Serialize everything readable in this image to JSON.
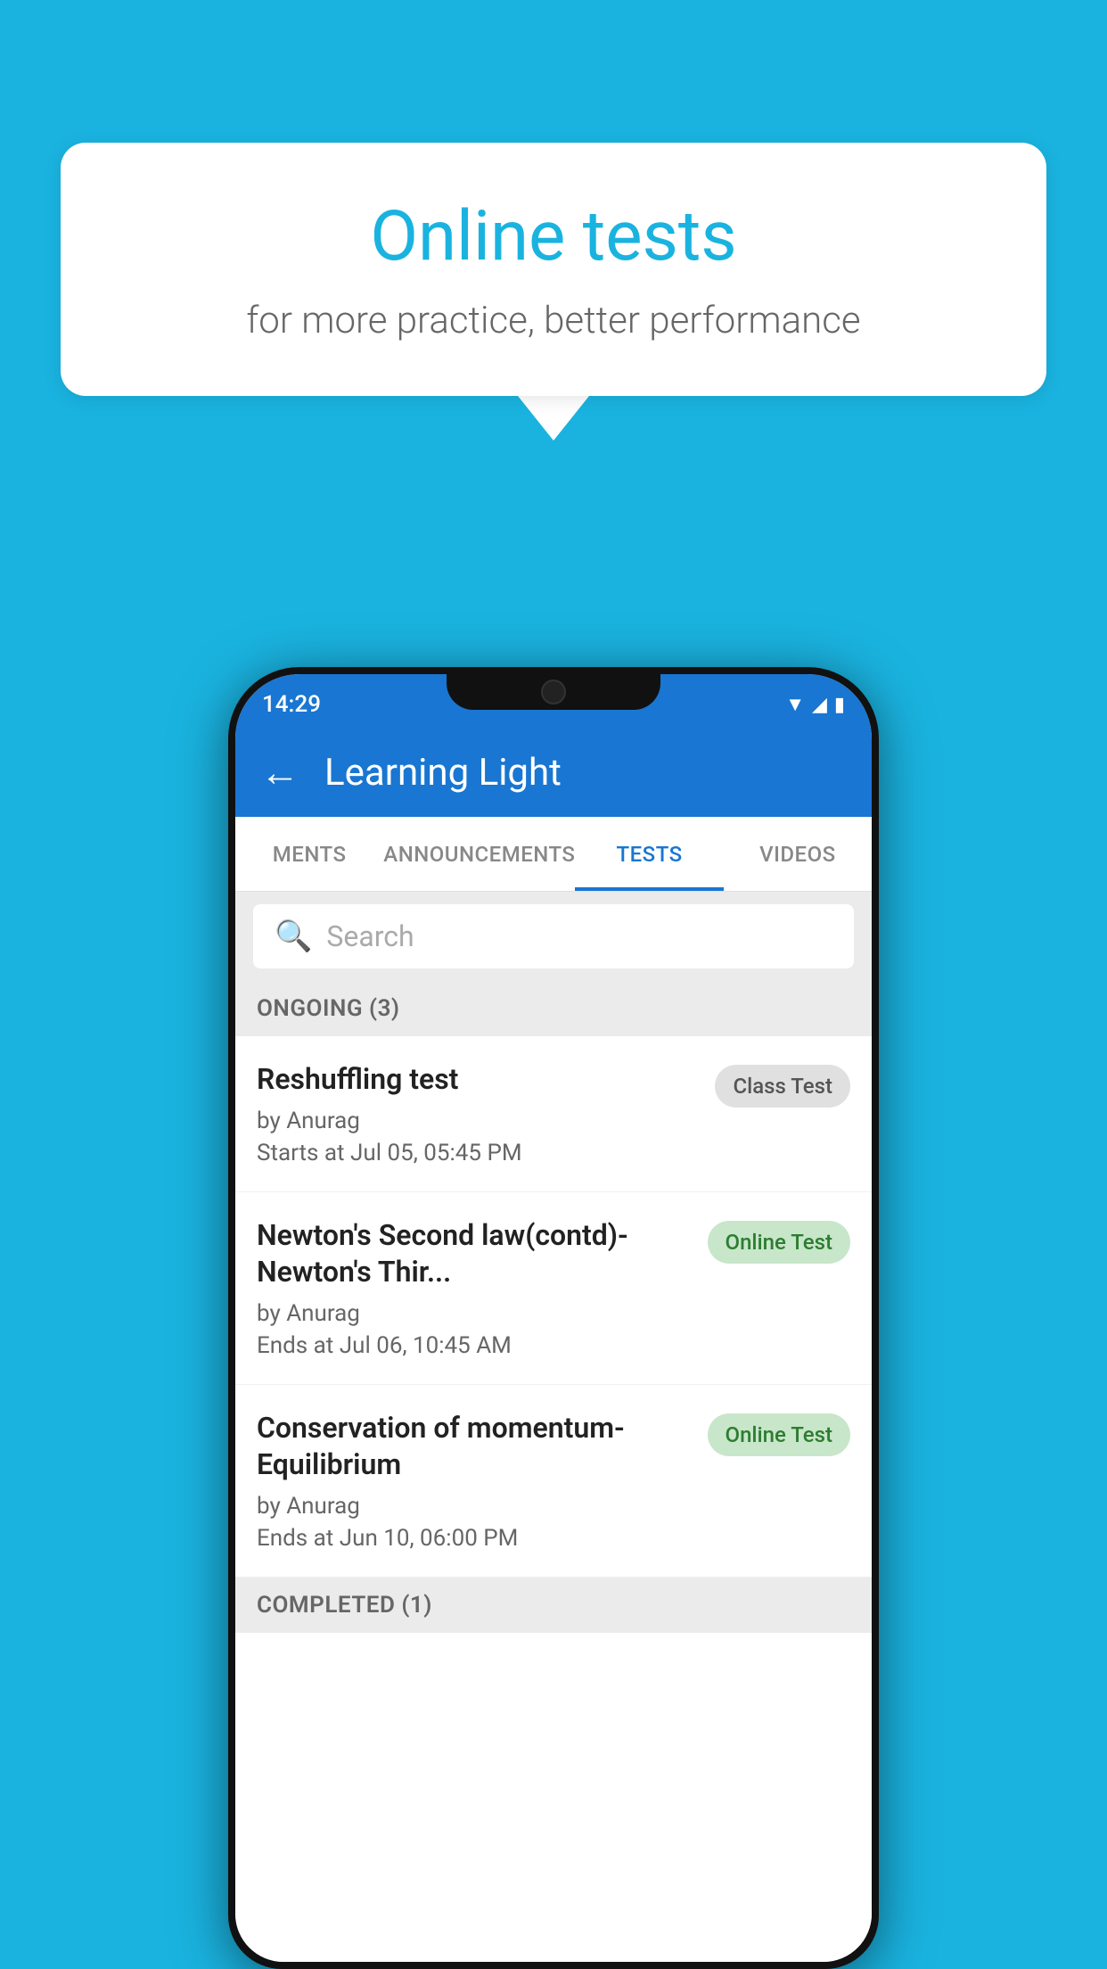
{
  "background_color": "#1ab3e0",
  "speech_bubble": {
    "title": "Online tests",
    "subtitle": "for more practice, better performance"
  },
  "phone": {
    "status_bar": {
      "time": "14:29",
      "icons": [
        "wifi",
        "signal",
        "battery"
      ]
    },
    "app_bar": {
      "back_label": "←",
      "title": "Learning Light"
    },
    "tabs": [
      {
        "label": "MENTS",
        "active": false
      },
      {
        "label": "ANNOUNCEMENTS",
        "active": false
      },
      {
        "label": "TESTS",
        "active": true
      },
      {
        "label": "VIDEOS",
        "active": false
      }
    ],
    "search": {
      "placeholder": "Search"
    },
    "ongoing_section": {
      "title": "ONGOING (3)"
    },
    "tests": [
      {
        "name": "Reshuffling test",
        "author": "by Anurag",
        "time_label": "Starts at",
        "time": "Jul 05, 05:45 PM",
        "badge": "Class Test",
        "badge_type": "class"
      },
      {
        "name": "Newton's Second law(contd)-Newton's Thir...",
        "author": "by Anurag",
        "time_label": "Ends at",
        "time": "Jul 06, 10:45 AM",
        "badge": "Online Test",
        "badge_type": "online"
      },
      {
        "name": "Conservation of momentum-Equilibrium",
        "author": "by Anurag",
        "time_label": "Ends at",
        "time": "Jun 10, 06:00 PM",
        "badge": "Online Test",
        "badge_type": "online"
      }
    ],
    "completed_section": {
      "title": "COMPLETED (1)"
    }
  }
}
